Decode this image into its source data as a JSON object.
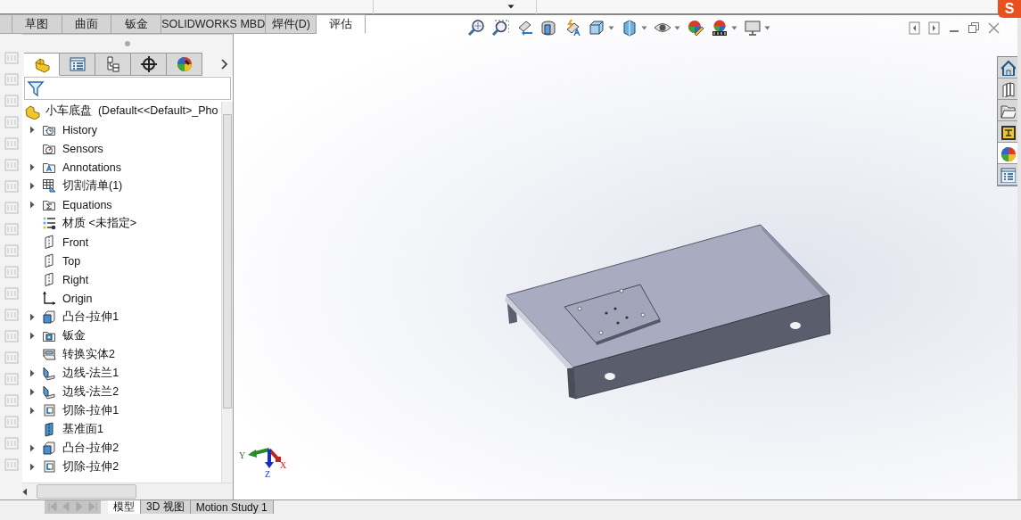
{
  "command_tabs": [
    {
      "label": "草图",
      "selected": false
    },
    {
      "label": "曲面",
      "selected": false
    },
    {
      "label": "钣金",
      "selected": false
    },
    {
      "label": "SOLIDWORKS MBD",
      "selected": false
    },
    {
      "label": "焊件(D)",
      "selected": false
    },
    {
      "label": "评估",
      "selected": true
    }
  ],
  "ime_badge": "S",
  "feature_manager": {
    "tabs": [
      {
        "kind": "tree",
        "selected": true
      },
      {
        "kind": "properties",
        "selected": false
      },
      {
        "kind": "config",
        "selected": false
      },
      {
        "kind": "dimxpert",
        "selected": false
      },
      {
        "kind": "display",
        "selected": false
      }
    ],
    "root": {
      "label": "小车底盘  (Default<<Default>_Pho"
    },
    "items": [
      {
        "label": "History",
        "kind": "history",
        "expandable": true
      },
      {
        "label": "Sensors",
        "kind": "sensors",
        "expandable": false
      },
      {
        "label": "Annotations",
        "kind": "annotations",
        "expandable": true
      },
      {
        "label": "切割清单(1)",
        "kind": "cutlist",
        "expandable": true
      },
      {
        "label": "Equations",
        "kind": "equations",
        "expandable": true
      },
      {
        "label": "材质 <未指定>",
        "kind": "material",
        "expandable": false
      },
      {
        "label": "Front",
        "kind": "plane",
        "expandable": false
      },
      {
        "label": "Top",
        "kind": "plane",
        "expandable": false
      },
      {
        "label": "Right",
        "kind": "plane",
        "expandable": false
      },
      {
        "label": "Origin",
        "kind": "origin",
        "expandable": false
      },
      {
        "label": "凸台-拉伸1",
        "kind": "extrude",
        "expandable": true
      },
      {
        "label": "钣金",
        "kind": "sheetmetal",
        "expandable": true
      },
      {
        "label": "转换实体2",
        "kind": "convert",
        "expandable": false
      },
      {
        "label": "边线-法兰1",
        "kind": "flange",
        "expandable": true
      },
      {
        "label": "边线-法兰2",
        "kind": "flange",
        "expandable": true
      },
      {
        "label": "切除-拉伸1",
        "kind": "cut",
        "expandable": true
      },
      {
        "label": "基准面1",
        "kind": "refplane",
        "expandable": false
      },
      {
        "label": "凸台-拉伸2",
        "kind": "extrude",
        "expandable": true
      },
      {
        "label": "切除-拉伸2",
        "kind": "cut",
        "expandable": true
      }
    ]
  },
  "viewport": {
    "heads_up_tools": [
      {
        "kind": "zoom-fit",
        "dropdown": false
      },
      {
        "kind": "zoom-area",
        "dropdown": false
      },
      {
        "kind": "previous-view",
        "dropdown": false
      },
      {
        "kind": "section-view",
        "dropdown": false
      },
      {
        "kind": "dynamic-annotation",
        "dropdown": false
      },
      {
        "kind": "view-orientation",
        "dropdown": true
      },
      {
        "kind": "display-style",
        "dropdown": true
      },
      {
        "kind": "hide-show",
        "dropdown": true
      },
      {
        "kind": "edit-appearance",
        "dropdown": false
      },
      {
        "kind": "apply-scene",
        "dropdown": true
      },
      {
        "kind": "view-settings",
        "dropdown": true
      }
    ],
    "triad": {
      "x": "X",
      "y": "Y",
      "z": "Z"
    },
    "task_pane": [
      {
        "kind": "home",
        "selected": false
      },
      {
        "kind": "library",
        "selected": false
      },
      {
        "kind": "explorer",
        "selected": false
      },
      {
        "kind": "palette",
        "selected": false
      },
      {
        "kind": "appearance",
        "selected": true
      },
      {
        "kind": "properties",
        "selected": false
      }
    ]
  },
  "bottom_tabs": [
    {
      "label": "模型",
      "selected": true
    },
    {
      "label": "3D 视图",
      "selected": false
    },
    {
      "label": "Motion Study 1",
      "selected": false
    }
  ]
}
